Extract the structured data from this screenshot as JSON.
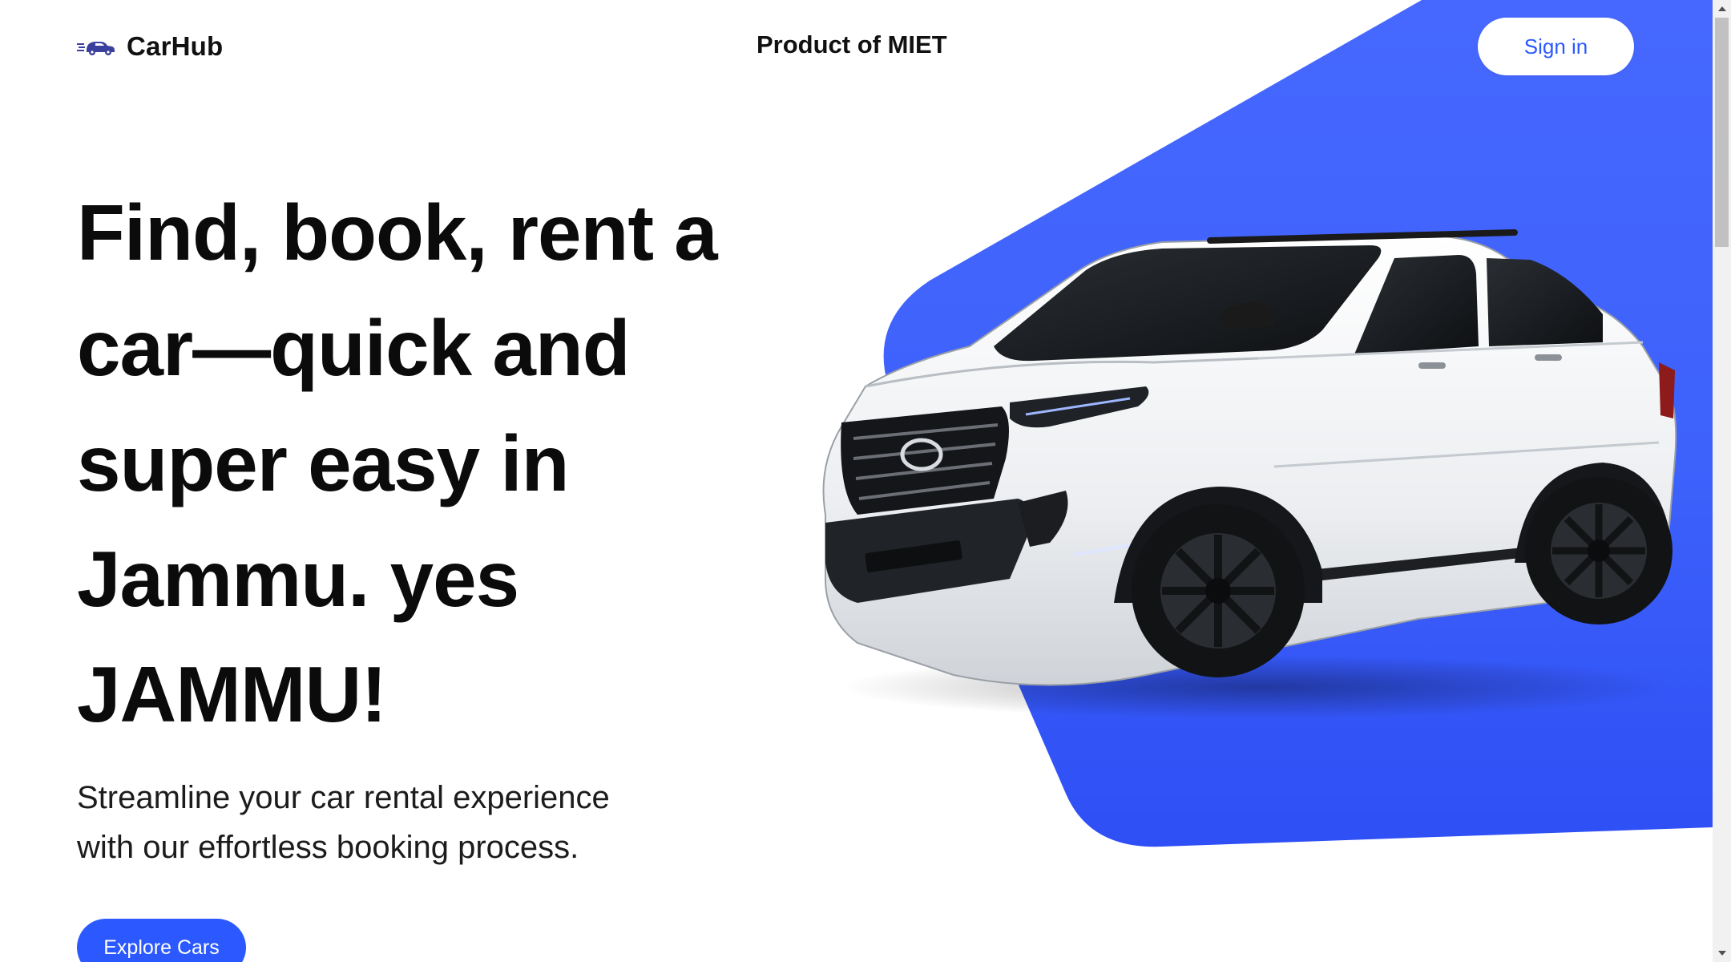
{
  "header": {
    "logo_text": "CarHub",
    "logo_icon": "car-speed-icon",
    "tagline": "Product of MIET",
    "sign_in_label": "Sign in"
  },
  "hero": {
    "title": "Find, book, rent a car—quick and super easy in Jammu. yes JAMMU!",
    "subtitle": "Streamline your car rental experience with our effortless booking process.",
    "cta_label": "Explore Cars",
    "image": "white-suv-car"
  },
  "colors": {
    "accent": "#2b59ff",
    "backdrop": "#3a5eff",
    "text": "#0b0b0b",
    "background": "#ffffff"
  }
}
